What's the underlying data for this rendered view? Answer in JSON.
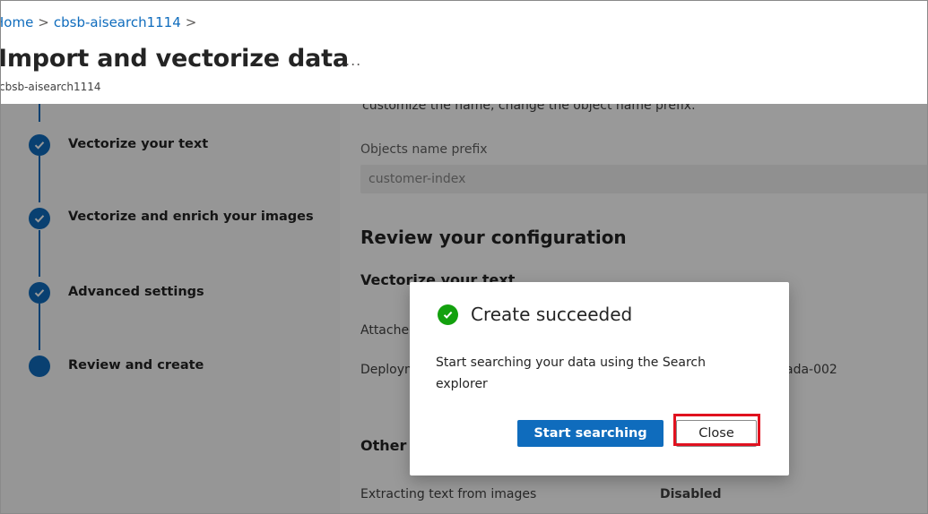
{
  "breadcrumb": {
    "home": "Home",
    "separator": ">",
    "service": "cbsb-aisearch1114",
    "trail_separator": ">"
  },
  "header": {
    "title": "Import and vectorize data",
    "more": "...",
    "subtitle": "cbsb-aisearch1114"
  },
  "stepper": {
    "steps": [
      {
        "label": "Vectorize your text",
        "state": "completed",
        "icon": "checkmark-icon"
      },
      {
        "label": "Vectorize and enrich your images",
        "state": "completed",
        "icon": "checkmark-icon"
      },
      {
        "label": "Advanced settings",
        "state": "completed",
        "icon": "checkmark-icon"
      },
      {
        "label": "Review and create",
        "state": "current",
        "icon": "filled-circle"
      }
    ]
  },
  "main": {
    "cut_text": "customize the name, change the object name prefix.",
    "objects_prefix_label": "Objects name prefix",
    "objects_prefix_value": "customer-index",
    "review_title": "Review your configuration",
    "vectorize_text_title": "Vectorize your text",
    "attached_label": "Attached",
    "deployment_label": "Deployment",
    "deployment_value": "ada-002",
    "other_title": "Other",
    "extracting_label": "Extracting text from images",
    "extracting_value": "Disabled"
  },
  "dialog": {
    "title": "Create succeeded",
    "message": "Start searching your data using the Search explorer",
    "primary_button": "Start searching",
    "close_button": "Close"
  },
  "colors": {
    "accent": "#0f6cbd",
    "success": "#13a10e",
    "highlight": "#e0121f",
    "overlay": "rgba(0,0,0,0.4)"
  }
}
